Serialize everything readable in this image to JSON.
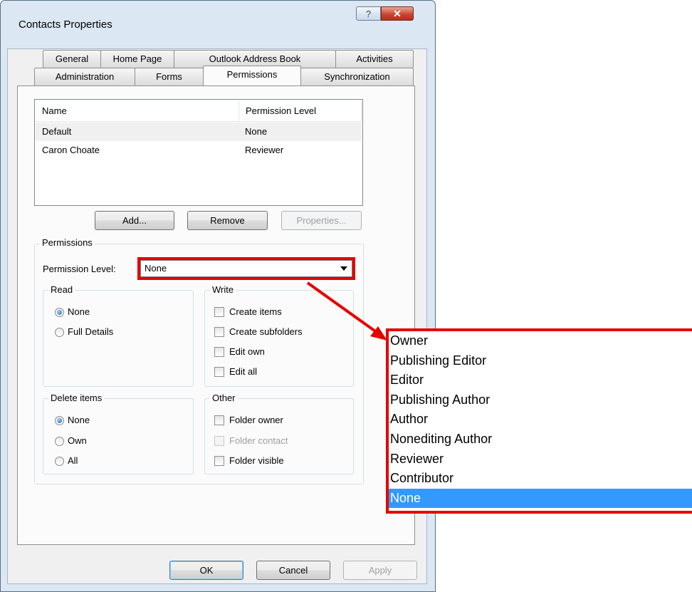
{
  "window": {
    "title": "Contacts Properties",
    "help_glyph": "?",
    "close_glyph": "✕"
  },
  "tabs": {
    "row1": [
      "General",
      "Home Page",
      "Outlook Address Book",
      "Activities"
    ],
    "row2": [
      "Administration",
      "Forms",
      "Permissions",
      "Synchronization"
    ],
    "active": "Permissions"
  },
  "listview": {
    "headers": [
      "Name",
      "Permission Level"
    ],
    "rows": [
      {
        "name": "Default",
        "level": "None"
      },
      {
        "name": "Caron Choate",
        "level": "Reviewer"
      }
    ]
  },
  "list_buttons": {
    "add": "Add...",
    "remove": "Remove",
    "properties": "Properties..."
  },
  "permissions": {
    "group_label": "Permissions",
    "level_label": "Permission Level:",
    "level_value": "None",
    "read": {
      "label": "Read",
      "options": [
        "None",
        "Full Details"
      ],
      "selected": "None"
    },
    "write": {
      "label": "Write",
      "options": [
        "Create items",
        "Create subfolders",
        "Edit own",
        "Edit all"
      ]
    },
    "delete": {
      "label": "Delete items",
      "options": [
        "None",
        "Own",
        "All"
      ],
      "selected": "None"
    },
    "other": {
      "label": "Other",
      "options": [
        "Folder owner",
        "Folder contact",
        "Folder visible"
      ]
    }
  },
  "dialog_buttons": {
    "ok": "OK",
    "cancel": "Cancel",
    "apply": "Apply"
  },
  "dropdown": {
    "items": [
      "Owner",
      "Publishing Editor",
      "Editor",
      "Publishing Author",
      "Author",
      "Nonediting Author",
      "Reviewer",
      "Contributor",
      "None"
    ],
    "selected": "None"
  },
  "colors": {
    "highlight": "#e60000",
    "selection": "#3399ff"
  }
}
